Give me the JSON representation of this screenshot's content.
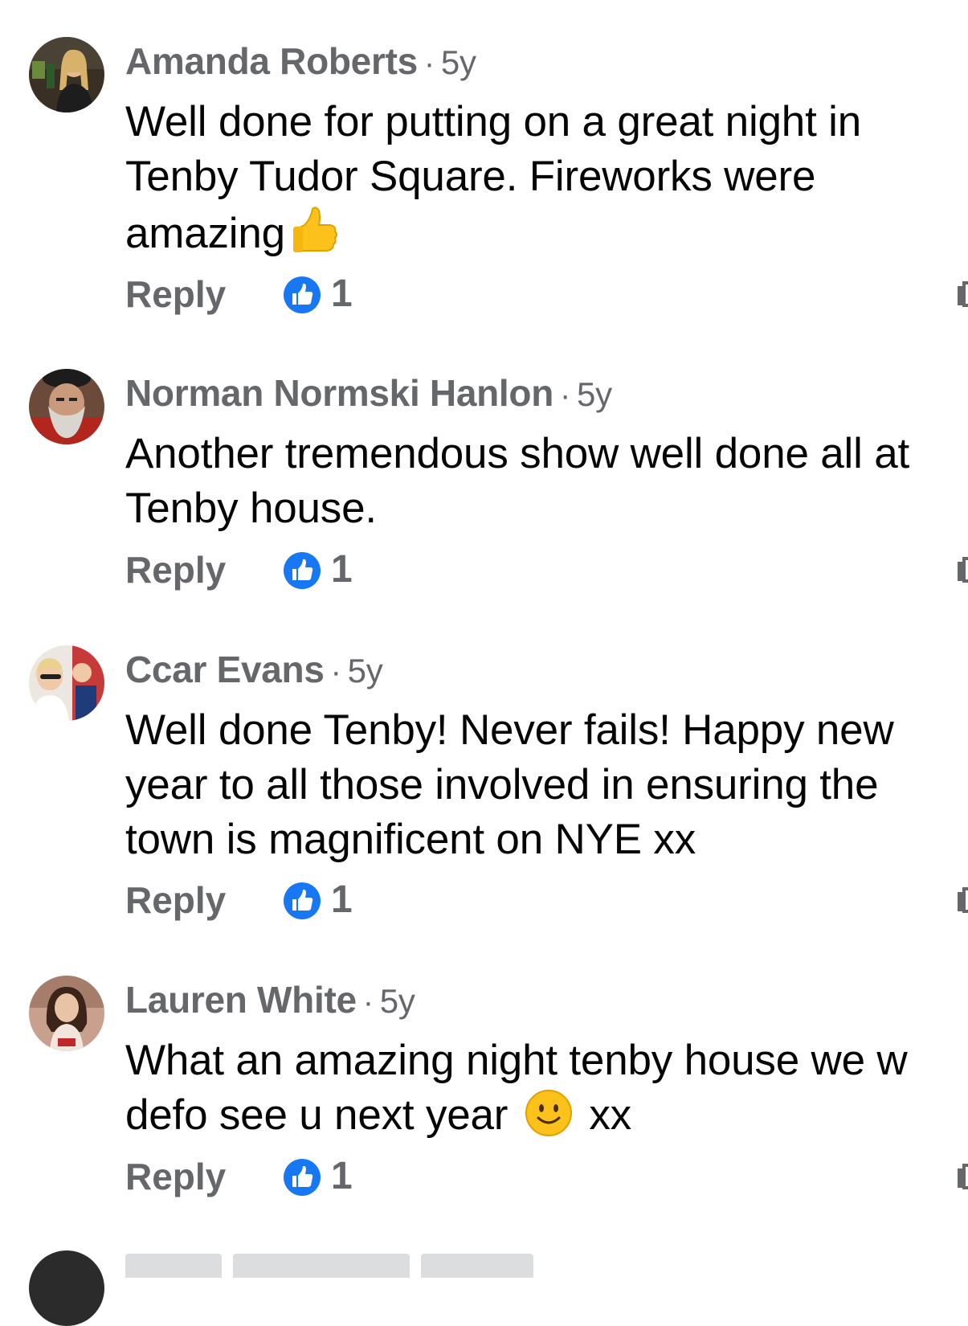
{
  "comments": [
    {
      "author": "Amanda Roberts",
      "separator": "·",
      "time": "5y",
      "text": "Well done for putting on a great night in\nTenby Tudor Square. Fireworks were\namazing",
      "emoji": "thumbs-up",
      "reply_label": "Reply",
      "like_count": "1"
    },
    {
      "author": "Norman Normski Hanlon",
      "separator": "·",
      "time": "5y",
      "text": "Another tremendous show well done all at\nTenby house.",
      "reply_label": "Reply",
      "like_count": "1"
    },
    {
      "author": "Ccar Evans",
      "separator": "·",
      "time": "5y",
      "text": "Well done Tenby! Never fails! Happy new\nyear to all those involved in ensuring the\ntown is magnificent on NYE xx",
      "reply_label": "Reply",
      "like_count": "1"
    },
    {
      "author": "Lauren White",
      "separator": "·",
      "time": "5y",
      "text_before_emoji": "What an amazing night tenby house we w\ndefo see u next year ",
      "emoji": "slightly-smiling-face",
      "text_after_emoji": " xx",
      "reply_label": "Reply",
      "like_count": "1"
    }
  ],
  "colors": {
    "like_blue": "#1877f2",
    "meta_gray": "#65676b",
    "text": "#050505"
  }
}
